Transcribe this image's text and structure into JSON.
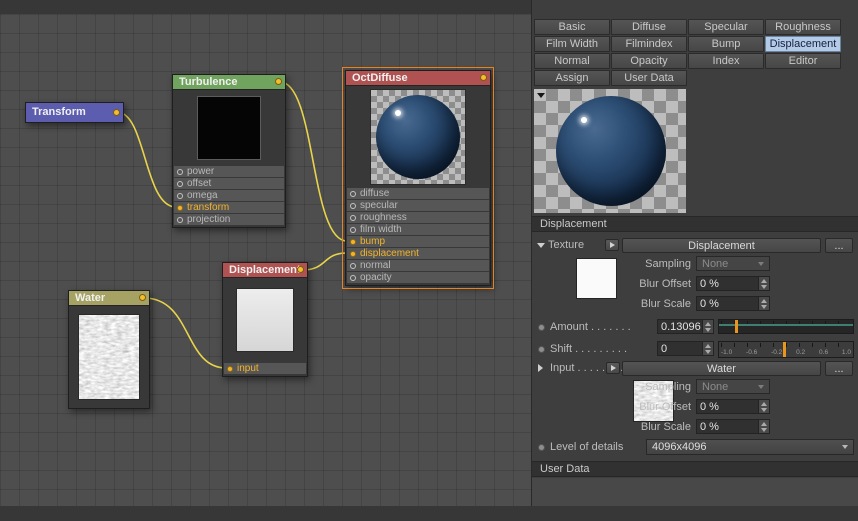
{
  "colors": {
    "wire": "#e8d44a",
    "port_highlight": "#f2b42c",
    "selection_outline": "#e8821e",
    "active_tab_bg": "#b4cbe8",
    "node_header_transform": "#5d5db0",
    "node_header_turbulence": "#6fa35e",
    "node_header_octdiffuse": "#b05252",
    "node_header_displacement": "#b05252",
    "node_header_water": "#a5a263"
  },
  "tabs": {
    "rows": [
      [
        "Basic",
        "Diffuse",
        "Specular",
        "Roughness"
      ],
      [
        "Film Width",
        "Filmindex",
        "Bump",
        "Displacement"
      ],
      [
        "Normal",
        "Opacity",
        "Index",
        "Editor"
      ],
      [
        "Assign",
        "User Data"
      ]
    ],
    "active": "Displacement"
  },
  "nodes": {
    "transform": {
      "title": "Transform"
    },
    "turbulence": {
      "title": "Turbulence",
      "ports": [
        "power",
        "offset",
        "omega",
        "transform",
        "projection"
      ]
    },
    "octdiffuse": {
      "title": "OctDiffuse",
      "ports": [
        "diffuse",
        "specular",
        "roughness",
        "film width",
        "bump",
        "displacement",
        "normal",
        "opacity"
      ]
    },
    "displacement": {
      "title": "Displacement",
      "ports": [
        "input"
      ]
    },
    "water": {
      "title": "Water"
    }
  },
  "panel": {
    "section_displacement": "Displacement",
    "texture": {
      "label": "Texture",
      "button": "Displacement",
      "more": "...",
      "sampling_label": "Sampling",
      "sampling_value": "None",
      "blur_offset_label": "Blur Offset",
      "blur_offset_value": "0 %",
      "blur_scale_label": "Blur Scale",
      "blur_scale_value": "0 %"
    },
    "amount": {
      "label": "Amount . . . . . . .",
      "value": "0.13096"
    },
    "shift": {
      "label": "Shift . . . . . . . . .",
      "value": "0",
      "ticks": [
        "-1.0",
        "-0.6",
        "-0.2",
        "0.2",
        "0.6",
        "1.0"
      ]
    },
    "input_row": {
      "label": "Input . . . . . . . .",
      "button": "Water",
      "more": "...",
      "sampling_label": "Sampling",
      "sampling_value": "None",
      "blur_offset_label": "Blur Offset",
      "blur_offset_value": "0 %",
      "blur_scale_label": "Blur Scale",
      "blur_scale_value": "0 %"
    },
    "level_of_details": {
      "label": "Level of details",
      "value": "4096x4096"
    },
    "section_user_data": "User Data"
  }
}
